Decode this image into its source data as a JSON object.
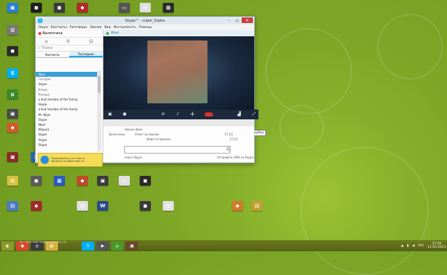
{
  "skype": {
    "title": "Skype™ - super_Sopka",
    "menu": [
      "Skype",
      "Контакты",
      "Разговоры",
      "Звонки",
      "Вид",
      "Инструменты",
      "Помощь"
    ],
    "user_name": "Валентина",
    "search_placeholder": "Поиск",
    "tabs": [
      "Контакты",
      "Последние"
    ],
    "contacts": [
      {
        "label": "Ирис",
        "selected": true
      },
      {
        "label": "Сегодня",
        "header": true
      },
      {
        "label": "Skype"
      },
      {
        "label": "Вчера",
        "header": true
      },
      {
        "label": "Раньше",
        "header": true
      },
      {
        "label": "a bud member of the family"
      },
      {
        "label": "Skype"
      },
      {
        "label": "a bud member of the family"
      },
      {
        "label": "Mr. Ирис"
      },
      {
        "label": "Skype"
      },
      {
        "label": "Ирис"
      },
      {
        "label": "Маруся"
      },
      {
        "label": "Skype"
      },
      {
        "label": "Skype"
      },
      {
        "label": "Skype"
      }
    ],
    "ad_text": "Подпишитесь на план и звоните на обычные те...",
    "chat_contact": "Ирис",
    "hangup_tooltip": "Положить трубку",
    "chat_lines": [
      {
        "from": "Звонок Ирис",
        "text": "",
        "time": ""
      },
      {
        "from": "Валентина",
        "text": "Ответ на звонок",
        "time": "17:24"
      },
      {
        "from": "",
        "text": "Файл отправлен",
        "time": "17:23"
      }
    ],
    "input_placeholder": "",
    "footer_left": "через Skype",
    "footer_right": "Отправить SMS на Skype"
  },
  "desktop_icons": [
    {
      "label": "",
      "color": "#2a7fd4",
      "glyph": "▣"
    },
    {
      "label": "",
      "color": "#1f1f1f",
      "glyph": "◼"
    },
    {
      "label": "",
      "color": "#3b3b3b",
      "glyph": "◼"
    },
    {
      "label": "",
      "color": "#b02a2a",
      "glyph": "◆"
    },
    {
      "label": "",
      "color": "#555555",
      "glyph": "▭"
    },
    {
      "label": "",
      "color": "#dddddd",
      "glyph": "▤"
    },
    {
      "label": "",
      "color": "#2b2b2b",
      "glyph": "▦"
    },
    {
      "label": "",
      "color": "#777777",
      "glyph": "▥"
    },
    {
      "label": "",
      "color": "#2a2a2a",
      "glyph": "◼"
    },
    {
      "label": "",
      "color": "#00aff0",
      "glyph": "S"
    },
    {
      "label": "",
      "color": "#3a8a2a",
      "glyph": "µ"
    },
    {
      "label": "",
      "color": "#4b4b4b",
      "glyph": "▣"
    },
    {
      "label": "",
      "color": "#d05a2a",
      "glyph": "◆"
    },
    {
      "label": "",
      "color": "#8a2a2a",
      "glyph": "▣"
    },
    {
      "label": "",
      "color": "#2a6ab0",
      "glyph": "▤"
    },
    {
      "label": "",
      "color": "#3a3a3a",
      "glyph": "◼"
    },
    {
      "label": "",
      "color": "#b0302a",
      "glyph": "◆"
    },
    {
      "label": "",
      "color": "#2a8a3a",
      "glyph": "▣"
    },
    {
      "label": "",
      "color": "#d8c040",
      "glyph": "▤"
    },
    {
      "label": "",
      "color": "#5a5a5a",
      "glyph": "◼"
    },
    {
      "label": "",
      "color": "#2a5ac0",
      "glyph": "▦"
    },
    {
      "label": "",
      "color": "#c04a2a",
      "glyph": "◆"
    },
    {
      "label": "",
      "color": "#3a3a3a",
      "glyph": "▣"
    },
    {
      "label": "",
      "color": "#e0e0e0",
      "glyph": "▭"
    },
    {
      "label": "",
      "color": "#2a2a2a",
      "glyph": "◼"
    },
    {
      "label": "",
      "color": "#4a7ac0",
      "glyph": "▤"
    },
    {
      "label": "",
      "color": "#a02a2a",
      "glyph": "◆"
    },
    {
      "label": "",
      "color": "#e0e0e0",
      "glyph": "▤"
    },
    {
      "label": "",
      "color": "#2a4a8a",
      "glyph": "W"
    },
    {
      "label": "",
      "color": "#3a3a3a",
      "glyph": "◼"
    },
    {
      "label": "",
      "color": "#e0e0e0",
      "glyph": "▤"
    },
    {
      "label": "",
      "color": "#d07a2a",
      "glyph": "◆"
    },
    {
      "label": "",
      "color": "#c0a030",
      "glyph": "▤"
    }
  ],
  "taskbar": {
    "preview": "10 - ТХ2b 1080    Запись: 00:01:15 / 00",
    "apps": [
      {
        "name": "start-button",
        "glyph": "◐",
        "color": "#8a9a2a"
      },
      {
        "name": "chrome-button",
        "glyph": "◉",
        "color": "#d24a2a"
      },
      {
        "name": "steam-button",
        "glyph": "◎",
        "color": "#3a3a3a"
      },
      {
        "name": "folder-button",
        "glyph": "▤",
        "color": "#d8b040"
      },
      {
        "name": "skype-button",
        "glyph": "S",
        "color": "#00aff0"
      },
      {
        "name": "video-button",
        "glyph": "▶",
        "color": "#555555"
      },
      {
        "name": "utorrent-button",
        "glyph": "µ",
        "color": "#4a9a2a"
      },
      {
        "name": "app-button",
        "glyph": "▣",
        "color": "#6a4a2a"
      }
    ],
    "lang": "РУС",
    "time": "17:29",
    "date": "11.05.2013"
  }
}
